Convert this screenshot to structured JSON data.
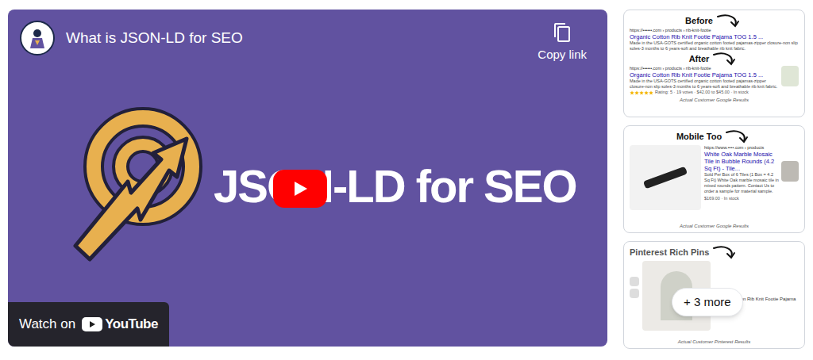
{
  "player": {
    "title": "What is JSON-LD for SEO",
    "copy_link": "Copy link",
    "thumbnail_text": "JSON-LD for SEO",
    "watch_on": "Watch on",
    "youtube": "YouTube"
  },
  "gallery": {
    "more": "+ 3 more",
    "cards": [
      {
        "kind": "before-after",
        "heading": "Before",
        "heading2": "After",
        "before": {
          "url": "https://••••••.com › products › rib-knit-footie",
          "title": "Organic Cotton Rib Knit Footie Pajama TOG 1.5 ...",
          "desc": "Made in the USA-GOTS certified organic cotton footed pajamas-zipper closure-non slip soles-3 months to 6 years-soft and breathable rib knit fabric."
        },
        "after": {
          "url": "https://••••••.com › products › rib-knit-footie",
          "title": "Organic Cotton Rib Knit Footie Pajama TOG 1.5 ...",
          "desc": "Made in the USA-GOTS certified organic cotton footed pajamas-zipper closure-non slip soles-3 months to 6 years-soft and breathable rib knit fabric.",
          "stars": 5,
          "rich": "Rating: 5 · 19 votes · $42.00 to $45.00 · In stock"
        },
        "caption": "Actual Customer Google Results"
      },
      {
        "kind": "mobile",
        "heading": "Mobile Too",
        "result": {
          "url": "https://www.••••.com › products",
          "title": "White Oak Marble Mosaic Tile in Bubble Rounds (4.2 Sq Ft) - Tile...",
          "desc": "Sold Per Box of 6 Tiles (1 Box = 4.2 Sq Ft) White Oak marble mosaic tile in mixed rounds pattern. Contact Us to order a sample for material sample.",
          "price": "$169.00 · In stock"
        },
        "caption": "Actual Customer Google Results"
      },
      {
        "kind": "pinterest",
        "heading": "Pinterest Rich Pins",
        "title": "Organic Cotton Rib Knit Footie Pajama TOG 1.5",
        "caption": "Actual Customer Pinterest Results"
      }
    ]
  }
}
